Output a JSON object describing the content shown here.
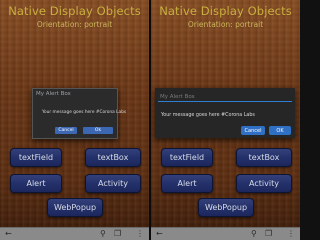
{
  "screens": [
    {
      "title": "Native Display Objects",
      "subtitle": "Orientation: portrait",
      "dialog": {
        "title": "My Alert Box",
        "message": "Your message goes here #Corona Labs",
        "cancel_label": "Cancel",
        "ok_label": "Ok"
      },
      "buttons": {
        "textfield": "textField",
        "textbox": "textBox",
        "alert": "Alert",
        "activity": "Activity",
        "webpopup": "WebPopup"
      }
    },
    {
      "title": "Native Display Objects",
      "subtitle": "Orientation: portrait",
      "dialog": {
        "title": "My Alert Box",
        "message": "Your message goes here #Corona Labs",
        "cancel_label": "Cancel",
        "ok_label": "OK"
      },
      "buttons": {
        "textfield": "textField",
        "textbox": "textBox",
        "alert": "Alert",
        "activity": "Activity",
        "webpopup": "WebPopup"
      }
    }
  ],
  "navbar": {
    "back_icon": "←",
    "search_icon": "⚲",
    "windows_icon": "❐",
    "menu_icon": "⋮",
    "icon_names": [
      "back-arrow-icon",
      "search-icon",
      "windows-icon",
      "menu-icon"
    ]
  },
  "colors": {
    "title": "#c9b040",
    "button_bg": "#24306a",
    "dialog_button": "#2f6fc4",
    "dialog_accent_line": "#2e7fd0"
  }
}
